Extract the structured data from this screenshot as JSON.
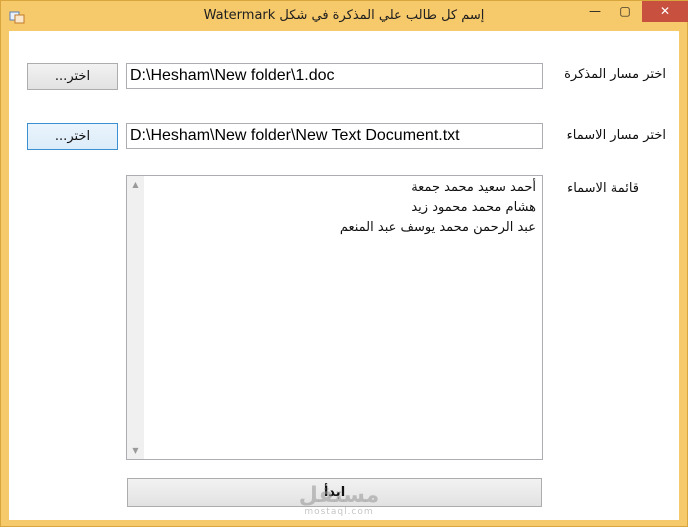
{
  "window": {
    "title": "إسم كل طالب علي المذكرة في شكل Watermark",
    "controls": {
      "minimize": "—",
      "maximize": "▢",
      "close": "✕"
    }
  },
  "form": {
    "doc_path_label": "اختر مسار المذكرة",
    "doc_path_value": "D:\\Hesham\\New folder\\1.doc",
    "doc_browse_button": "اختر...",
    "names_path_label": "اختر مسار الاسماء",
    "names_path_value": "D:\\Hesham\\New folder\\New Text Document.txt",
    "names_browse_button": "اختر...",
    "names_list_label": "قائمة الاسماء",
    "names_list": [
      "أحمد سعيد محمد جمعة",
      "هشام محمد محمود زيد",
      "عبد الرحمن محمد يوسف عبد المنعم"
    ],
    "start_button": "ابدأ"
  },
  "watermark": {
    "main": "مستقل",
    "sub": "mostaql.com"
  }
}
